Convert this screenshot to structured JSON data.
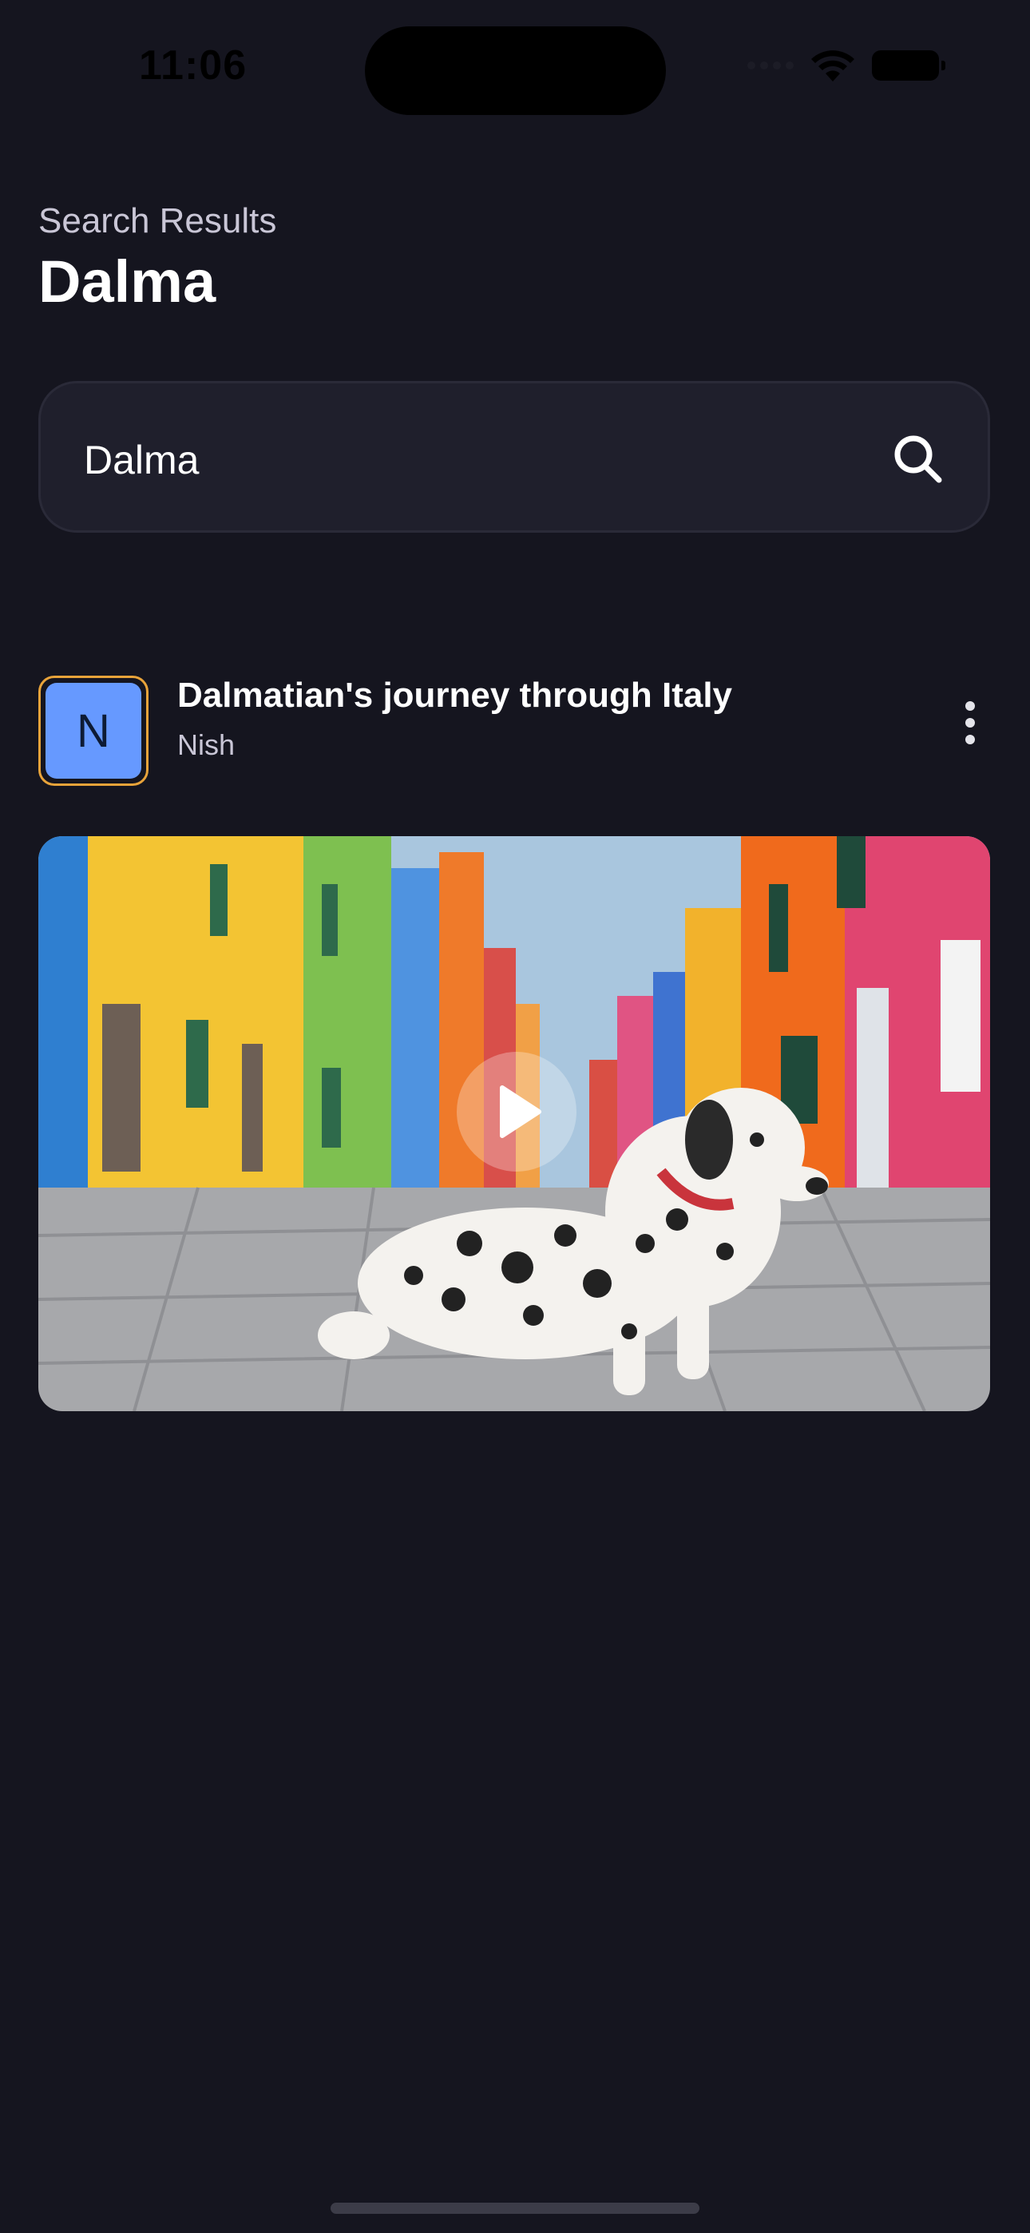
{
  "status_bar": {
    "time": "11:06"
  },
  "header": {
    "subtitle": "Search Results",
    "title": "Dalma"
  },
  "search": {
    "value": "Dalma",
    "icon": "search-icon"
  },
  "results": [
    {
      "avatar_letter": "N",
      "title": "Dalmatian's journey through Italy",
      "author": "Nish",
      "menu_icon": "more-vertical-icon",
      "thumbnail_icon": "play-icon"
    }
  ],
  "colors": {
    "background": "#15151f",
    "search_background": "#1f1f2c",
    "avatar_border": "#e8a33a",
    "avatar_fill": "#6699ff"
  }
}
